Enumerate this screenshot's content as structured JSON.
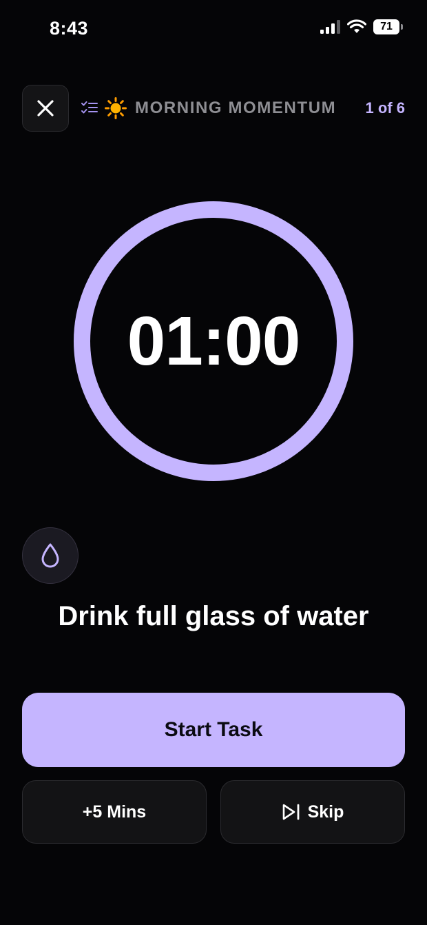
{
  "status_bar": {
    "time": "8:43",
    "battery": "71"
  },
  "header": {
    "close_icon": "close-icon",
    "list_icon": "checklist-icon",
    "emoji_icon": "sun-icon",
    "routine_name": "MORNING MOMENTUM",
    "step_counter": "1 of 6"
  },
  "timer": {
    "display": "01:00",
    "progress": 1.0
  },
  "task": {
    "icon": "water-drop-icon",
    "title": "Drink full glass of water"
  },
  "actions": {
    "start_label": "Start Task",
    "add_time_label": "+5 Mins",
    "skip_label": "Skip",
    "skip_icon": "skip-forward-icon"
  },
  "colors": {
    "background": "#050507",
    "accent": "#c5b5ff",
    "muted_text": "#8e8e93",
    "surface": "#131315"
  }
}
